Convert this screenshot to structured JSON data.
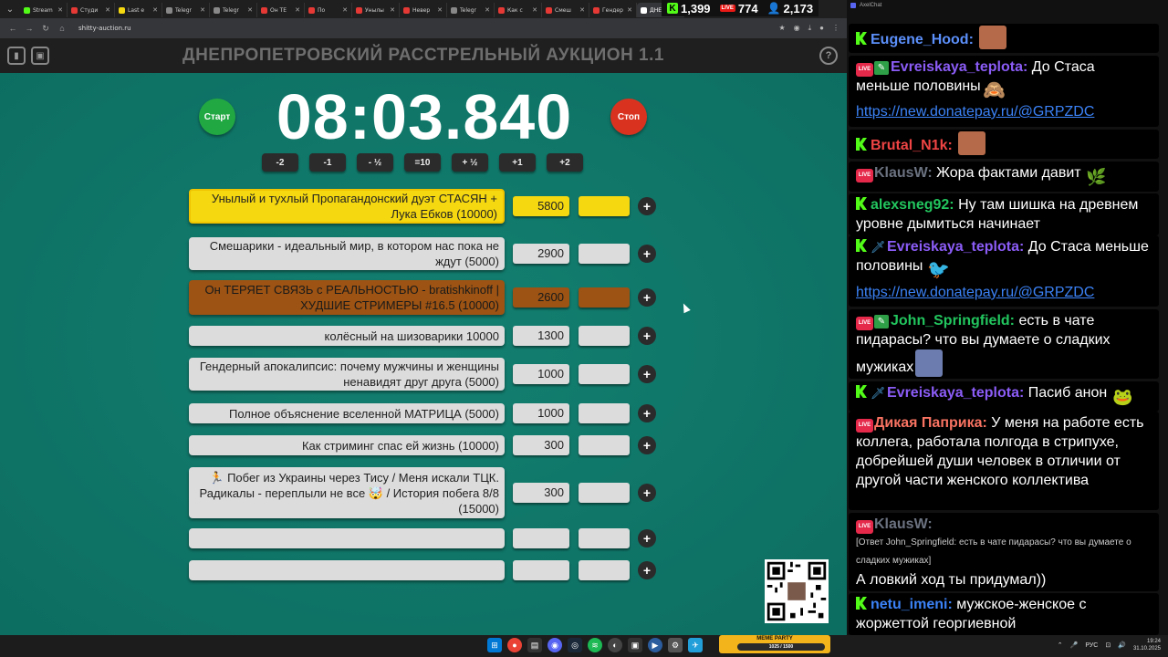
{
  "browser": {
    "tabs": [
      {
        "label": "Stream",
        "color": "#53fc18"
      },
      {
        "label": "Студи",
        "color": "#e53935"
      },
      {
        "label": "Last e",
        "color": "#f5d80f"
      },
      {
        "label": "Telegr",
        "color": "#888888"
      },
      {
        "label": "Telegr",
        "color": "#888888"
      },
      {
        "label": "Он ТЕ",
        "color": "#e53935"
      },
      {
        "label": "По",
        "color": "#e53935"
      },
      {
        "label": "Унылы",
        "color": "#e53935"
      },
      {
        "label": "Невер",
        "color": "#e53935"
      },
      {
        "label": "Telegr",
        "color": "#888888"
      },
      {
        "label": "Как с",
        "color": "#e53935"
      },
      {
        "label": "Смеш",
        "color": "#e53935"
      },
      {
        "label": "Гендер",
        "color": "#e53935"
      },
      {
        "label": "ДНЕ",
        "color": "#ffffff"
      }
    ],
    "url": "shitty-auction.ru"
  },
  "stats": {
    "kick": "1,399",
    "live": "774",
    "viewers": "2,173"
  },
  "app": {
    "title": "ДНЕПРОПЕТРОВСКИЙ РАССТРЕЛЬНЫЙ АУКЦИОН 1.1",
    "help": "?",
    "start_label": "Старт",
    "stop_label": "Стоп",
    "timer": "08:03.840",
    "adjust": [
      "-2",
      "-1",
      "- ½",
      "=10",
      "+ ½",
      "+1",
      "+2"
    ],
    "plus": "+"
  },
  "lots": [
    {
      "name": "Унылый и тухлый Пропагандонский дуэт СТАСЯН + Лука Ебков (10000)",
      "amount": "5800",
      "style": "gold"
    },
    {
      "name": "Смешарики - идеальный мир, в котором нас пока не ждут (5000)",
      "amount": "2900",
      "style": "silver"
    },
    {
      "name": "Он ТЕРЯЕТ СВЯЗЬ с РЕАЛЬНОСТЬЮ - bratishkinoff | ХУДШИЕ СТРИМЕРЫ #16.5 (10000)",
      "amount": "2600",
      "style": "bronze"
    },
    {
      "name": "колёсный на шизоварики 10000",
      "amount": "1300",
      "style": "plain"
    },
    {
      "name": "Гендерный апокалипсис: почему мужчины и женщины ненавидят друг друга (5000)",
      "amount": "1000",
      "style": "plain"
    },
    {
      "name": "Полное объяснение вселенной МАТРИЦА (5000)",
      "amount": "1000",
      "style": "plain"
    },
    {
      "name": "Как стриминг спас ей жизнь (10000)",
      "amount": "300",
      "style": "plain"
    },
    {
      "name": "🏃 Побег из Украины через Тису / Меня искали ТЦК. Радикалы - переплыли не все 🤯 / История побега 8/8 (15000)",
      "amount": "300",
      "style": "plain"
    },
    {
      "name": "",
      "amount": "",
      "style": "plain"
    },
    {
      "name": "",
      "amount": "",
      "style": "plain"
    }
  ],
  "chat": {
    "title": "AxelChat",
    "messages": [
      {
        "platform": "kick",
        "user": "Eugene_Hood:",
        "user_color": "#5b8ff9",
        "text": "",
        "emote": "face"
      },
      {
        "platform": "live-edit",
        "user": "Evreiskaya_teplota:",
        "user_color": "#8b5cf6",
        "text": "До Стаса меньше половины",
        "emote": "monkey",
        "link": "https://new.donatepay.ru/@GRPZDC"
      },
      {
        "platform": "kick",
        "user": "Brutal_N1k:",
        "user_color": "#ef4444",
        "text": "",
        "emote": "face"
      },
      {
        "platform": "live",
        "user": "KlausW:",
        "user_color": "#6b7280",
        "text": "Жора фактами давит",
        "emote": "weed"
      },
      {
        "platform": "kick",
        "user": "alexsneg92:",
        "user_color": "#22c55e",
        "text": "Ну там шишка на древнем уровне дымиться начинает"
      },
      {
        "platform": "kick-sword",
        "user": "Evreiskaya_teplota:",
        "user_color": "#8b5cf6",
        "text": "До Стаса меньше половины",
        "emote": "bird",
        "link": "https://new.donatepay.ru/@GRPZDC"
      },
      {
        "platform": "live-edit",
        "user": "John_Springfield:",
        "user_color": "#22c55e",
        "text": "есть в чате пидарасы? что вы думаете о сладких мужиках",
        "emote": "putin"
      },
      {
        "platform": "kick-sword",
        "user": "Evreiskaya_teplota:",
        "user_color": "#8b5cf6",
        "text": "Пасиб анон",
        "emote": "pepe"
      },
      {
        "platform": "live",
        "user": "Дикая Паприка:",
        "user_color": "#f97362",
        "text": "У меня на работе есть коллега, работала полгода в стрипухе, добрейшей души человек в отличии от другой части женского коллектива"
      },
      {
        "platform": "live",
        "user": "KlausW:",
        "user_color": "#6b7280",
        "reply": "[Ответ John_Springfield: есть в чате пидарасы? что вы думаете о сладких мужиках]",
        "text": "А ловкий ход ты придумал))"
      },
      {
        "platform": "kick",
        "user": "netu_imeni:",
        "user_color": "#3b82f6",
        "text": "мужское-женское с жоржеттой георгиевной"
      }
    ]
  },
  "taskbar": {
    "meme_title": "MEME PARTY",
    "meme_progress": "1025 / 1500",
    "lang": "РУС",
    "time": "19:24",
    "date": "31.10.2025"
  },
  "colors": {
    "background": "#0f7768",
    "gold": "#f5d80f",
    "silver": "#dcdcdc",
    "bronze": "#9c5313",
    "start": "#22a843",
    "stop": "#d9331f"
  }
}
